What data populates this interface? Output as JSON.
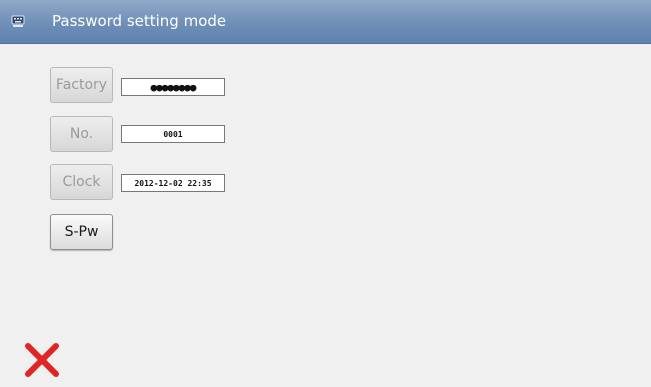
{
  "window": {
    "title": "Password setting mode",
    "title_icon": "keyboard-icon"
  },
  "rows": [
    {
      "label": "Factory",
      "value": "●●●●●●●●",
      "enabled": false
    },
    {
      "label": "No.",
      "value": "0001",
      "enabled": false
    },
    {
      "label": "Clock",
      "value": "2012-12-02 22:35",
      "enabled": false
    }
  ],
  "spw_button": {
    "label": "S-Pw"
  },
  "cancel_button": {
    "icon": "close-x-icon",
    "color": "#e02525"
  },
  "colors": {
    "titlebar": "#6f8fb7",
    "background": "#f0f0f0"
  }
}
